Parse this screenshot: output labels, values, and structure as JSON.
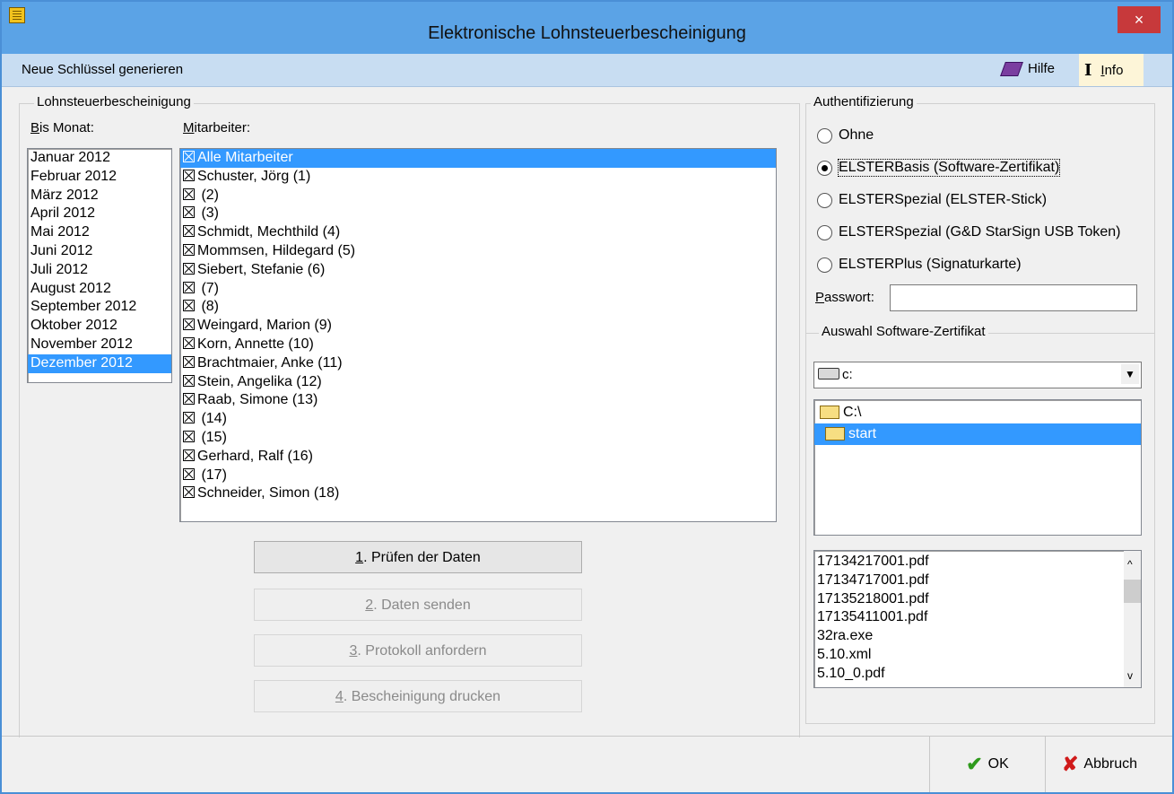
{
  "window": {
    "title": "Elektronische Lohnsteuerbescheinigung",
    "close": "×"
  },
  "toolbar": {
    "new_keys": "Neue Schlüssel generieren",
    "help": "Hilfe",
    "info": "Info"
  },
  "tax": {
    "group": "Lohnsteuerbescheinigung",
    "month_label": "Bis Monat:",
    "employee_label": "Mitarbeiter:",
    "months": [
      "Januar 2012",
      "Februar 2012",
      "März 2012",
      "April 2012",
      "Mai 2012",
      "Juni 2012",
      "Juli 2012",
      "August 2012",
      "September 2012",
      "Oktober 2012",
      "November 2012",
      "Dezember 2012"
    ],
    "selected_month": 11,
    "employees": [
      "Alle Mitarbeiter",
      "Schuster, Jörg (1)",
      "(2)",
      "(3)",
      "Schmidt, Mechthild (4)",
      "Mommsen, Hildegard (5)",
      "Siebert, Stefanie (6)",
      "(7)",
      "(8)",
      "Weingard, Marion (9)",
      "Korn, Annette (10)",
      "Brachtmaier, Anke (11)",
      "Stein, Angelika (12)",
      "Raab, Simone (13)",
      "(14)",
      "(15)",
      "Gerhard, Ralf (16)",
      "(17)",
      "Schneider, Simon (18)"
    ],
    "selected_employee": 0
  },
  "actions": {
    "check": {
      "num": "1",
      "rest": ". Prüfen der Daten"
    },
    "send": {
      "num": "2",
      "rest": ". Daten senden"
    },
    "protocol": {
      "num": "3",
      "rest": ". Protokoll anfordern"
    },
    "print": {
      "num": "4",
      "rest": ". Bescheinigung drucken"
    }
  },
  "auth": {
    "group": "Authentifizierung",
    "options": [
      "Ohne",
      "ELSTERBasis (Software-Zertifikat)",
      "ELSTERSpezial (ELSTER-Stick)",
      "ELSTERSpezial (G&D StarSign USB Token)",
      "ELSTERPlus (Signaturkarte)"
    ],
    "selected": 1,
    "password_label": "Passwort:",
    "password_value": ""
  },
  "cert": {
    "group": "Auswahl Software-Zertifikat",
    "drive": "c:",
    "folders": [
      "C:\\",
      "start"
    ],
    "selected_folder": 1,
    "files": [
      "17134217001.pdf",
      "17134717001.pdf",
      "17135218001.pdf",
      "17135411001.pdf",
      "32ra.exe",
      "5.10.xml",
      "5.10_0.pdf"
    ]
  },
  "footer": {
    "ok": "OK",
    "cancel": "Abbruch"
  }
}
